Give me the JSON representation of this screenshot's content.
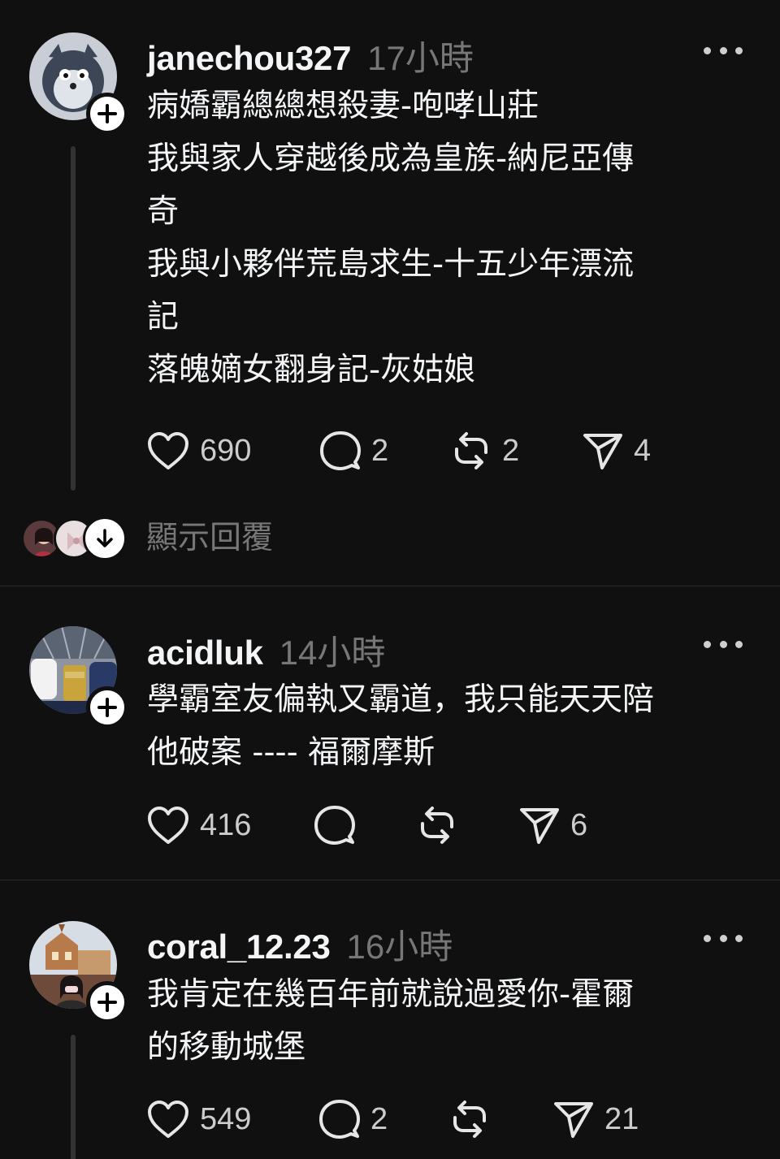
{
  "posts": [
    {
      "username": "janechou327",
      "time": "17小時",
      "lines": [
        "病嬌霸總總想殺妻-咆哮山莊",
        "我與家人穿越後成為皇族-納尼亞傳",
        "奇",
        "我與小夥伴荒島求生-十五少年漂流",
        "記",
        "落魄嫡女翻身記-灰姑娘"
      ],
      "likes": "690",
      "comments": "2",
      "reposts": "2",
      "shares": "4"
    },
    {
      "username": "acidluk",
      "time": "14小時",
      "lines": [
        "學霸室友偏執又霸道，我只能天天陪",
        "他破案 ---- 福爾摩斯"
      ],
      "likes": "416",
      "comments": "",
      "reposts": "",
      "shares": "6"
    },
    {
      "username": "coral_12.23",
      "time": "16小時",
      "lines": [
        "我肯定在幾百年前就說過愛你-霍爾",
        "的移動城堡"
      ],
      "likes": "549",
      "comments": "2",
      "reposts": "",
      "shares": "21"
    }
  ],
  "show_replies": "顯示回覆",
  "icons": {
    "like": "heart-icon",
    "comment": "comment-bubble-icon",
    "repost": "repost-icon",
    "share": "send-icon",
    "more": "more-dots-icon",
    "follow": "plus-icon",
    "expand": "arrow-down-icon"
  },
  "colors": {
    "background": "#101010",
    "text": "#f3f5f7",
    "muted": "#777777",
    "divider": "#2d2d2d"
  }
}
